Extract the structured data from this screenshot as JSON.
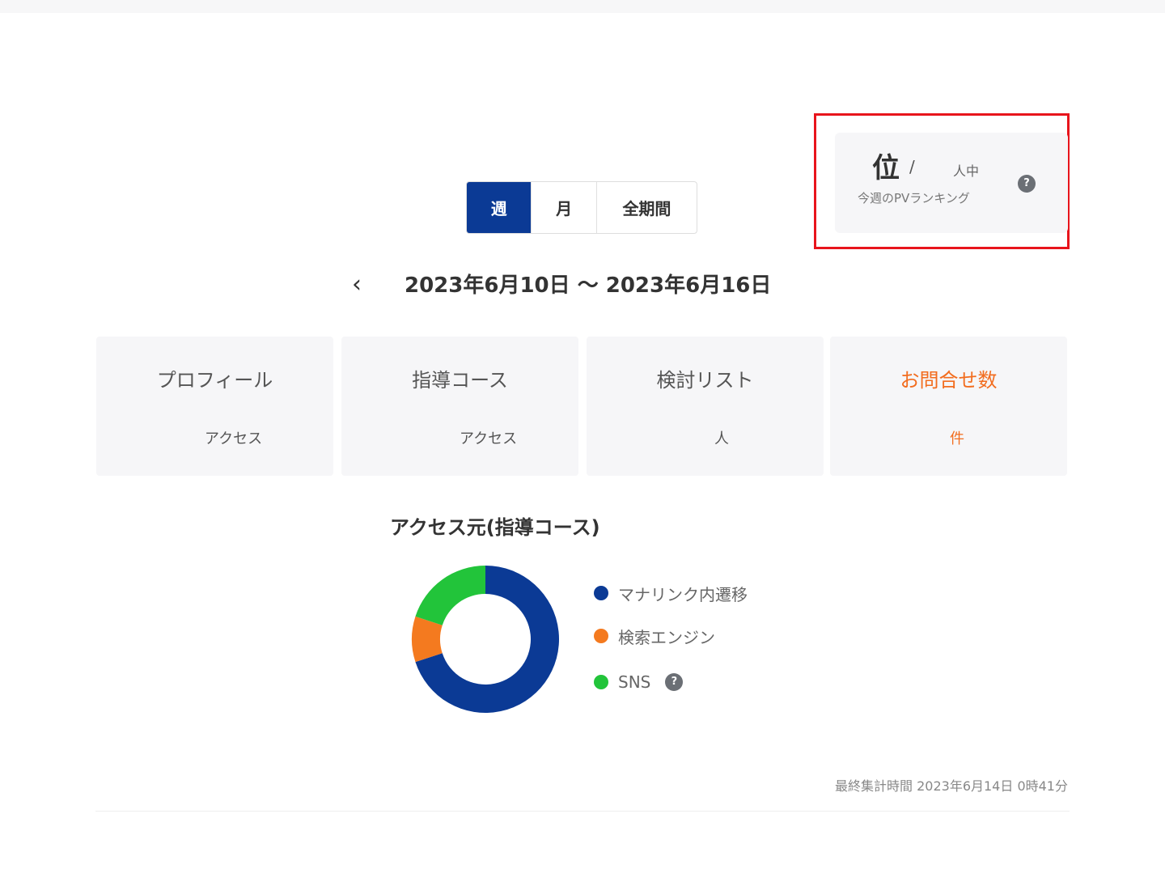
{
  "ranking": {
    "value": "位",
    "separator": "/",
    "total_unit": "人中",
    "title": "今週のPVランキング",
    "help": "?"
  },
  "period_tabs": [
    "週",
    "月",
    "全期間"
  ],
  "active_period": "週",
  "date_nav": {
    "prev": "‹",
    "range": "2023年6月10日 ～ 2023年6月16日"
  },
  "stats": [
    {
      "title": "プロフィール",
      "unit": "アクセス"
    },
    {
      "title": "指導コース",
      "unit": "アクセス"
    },
    {
      "title": "検討リスト",
      "unit": "人"
    },
    {
      "title": "お問合せ数",
      "unit": "件"
    }
  ],
  "access_source": {
    "title": "アクセス元(指導コース)",
    "help": "?",
    "legend": [
      {
        "label": "マナリンク内遷移",
        "color": "#0b3a95"
      },
      {
        "label": "検索エンジン",
        "color": "#f47a1f"
      },
      {
        "label": "SNS",
        "color": "#22c43a"
      }
    ]
  },
  "chart_data": {
    "type": "pie",
    "title": "アクセス元(指導コース)",
    "categories": [
      "マナリンク内遷移",
      "検索エンジン",
      "SNS"
    ],
    "values": [
      70,
      10,
      20
    ],
    "colors": [
      "#0b3a95",
      "#f47a1f",
      "#22c43a"
    ],
    "donut": true,
    "legend": "right"
  },
  "updated_at": "最終集計時間 2023年6月14日 0時41分"
}
